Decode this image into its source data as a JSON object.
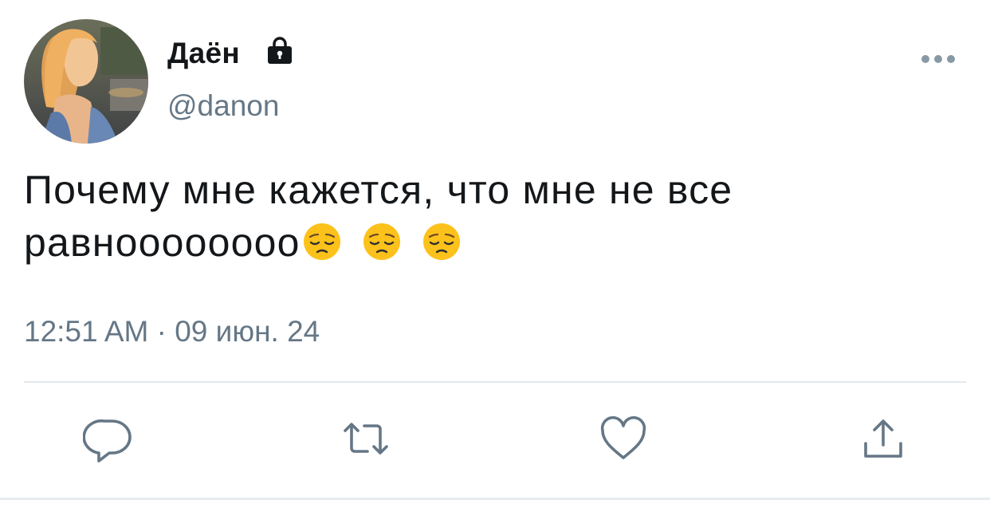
{
  "tweet": {
    "display_name": "Даён",
    "handle": "@danon",
    "text_line1": "Почему мне кажется, что мне не все",
    "text_line2": "равноооооооо",
    "emojis": [
      "pensive-face",
      "pensive-face",
      "pensive-face"
    ],
    "time": "12:51 AM",
    "separator": "·",
    "date": "09 июн. 24",
    "protected_icon": "lock-icon",
    "more_icon": "more-icon"
  },
  "actions": [
    {
      "name": "reply",
      "icon": "reply-icon"
    },
    {
      "name": "retweet",
      "icon": "retweet-icon"
    },
    {
      "name": "like",
      "icon": "heart-icon"
    },
    {
      "name": "share",
      "icon": "share-icon"
    }
  ],
  "colors": {
    "text": "#14171a",
    "secondary": "#657786",
    "divider": "#e1e8ed",
    "emoji": "#fcc21b"
  }
}
